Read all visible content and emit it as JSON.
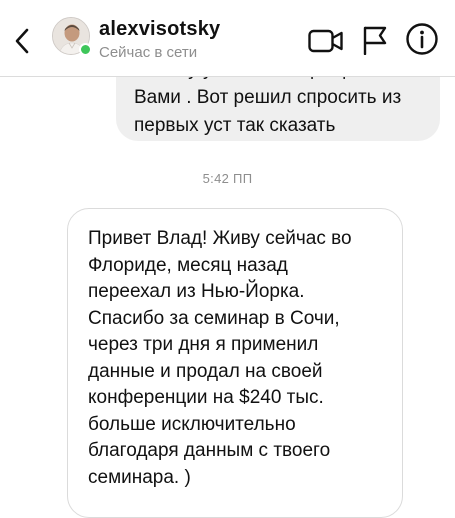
{
  "header": {
    "username": "alexvisotsky",
    "status": "Сейчас в сети",
    "accent_online": "#3ec65a",
    "icons": [
      "back-icon",
      "video-call-icon",
      "flag-icon",
      "info-icon"
    ]
  },
  "messages": {
    "sent_partial": "почему у всех ассоциации с\nВами . Вот решил спросить из\nпервых уст так сказать",
    "timestamp": "5:42 ПП",
    "received": "Привет Влад! Живу сейчас во\nФлориде, месяц назад\nпереехал из Нью-Йорка.\nСпасибо за семинар в Сочи,\nчерез три дня я применил\nданные и продал на своей\nконференции на $240 тыс.\nбольше исключительно\nблагодаря данным с твоего\nсеминара. )"
  }
}
